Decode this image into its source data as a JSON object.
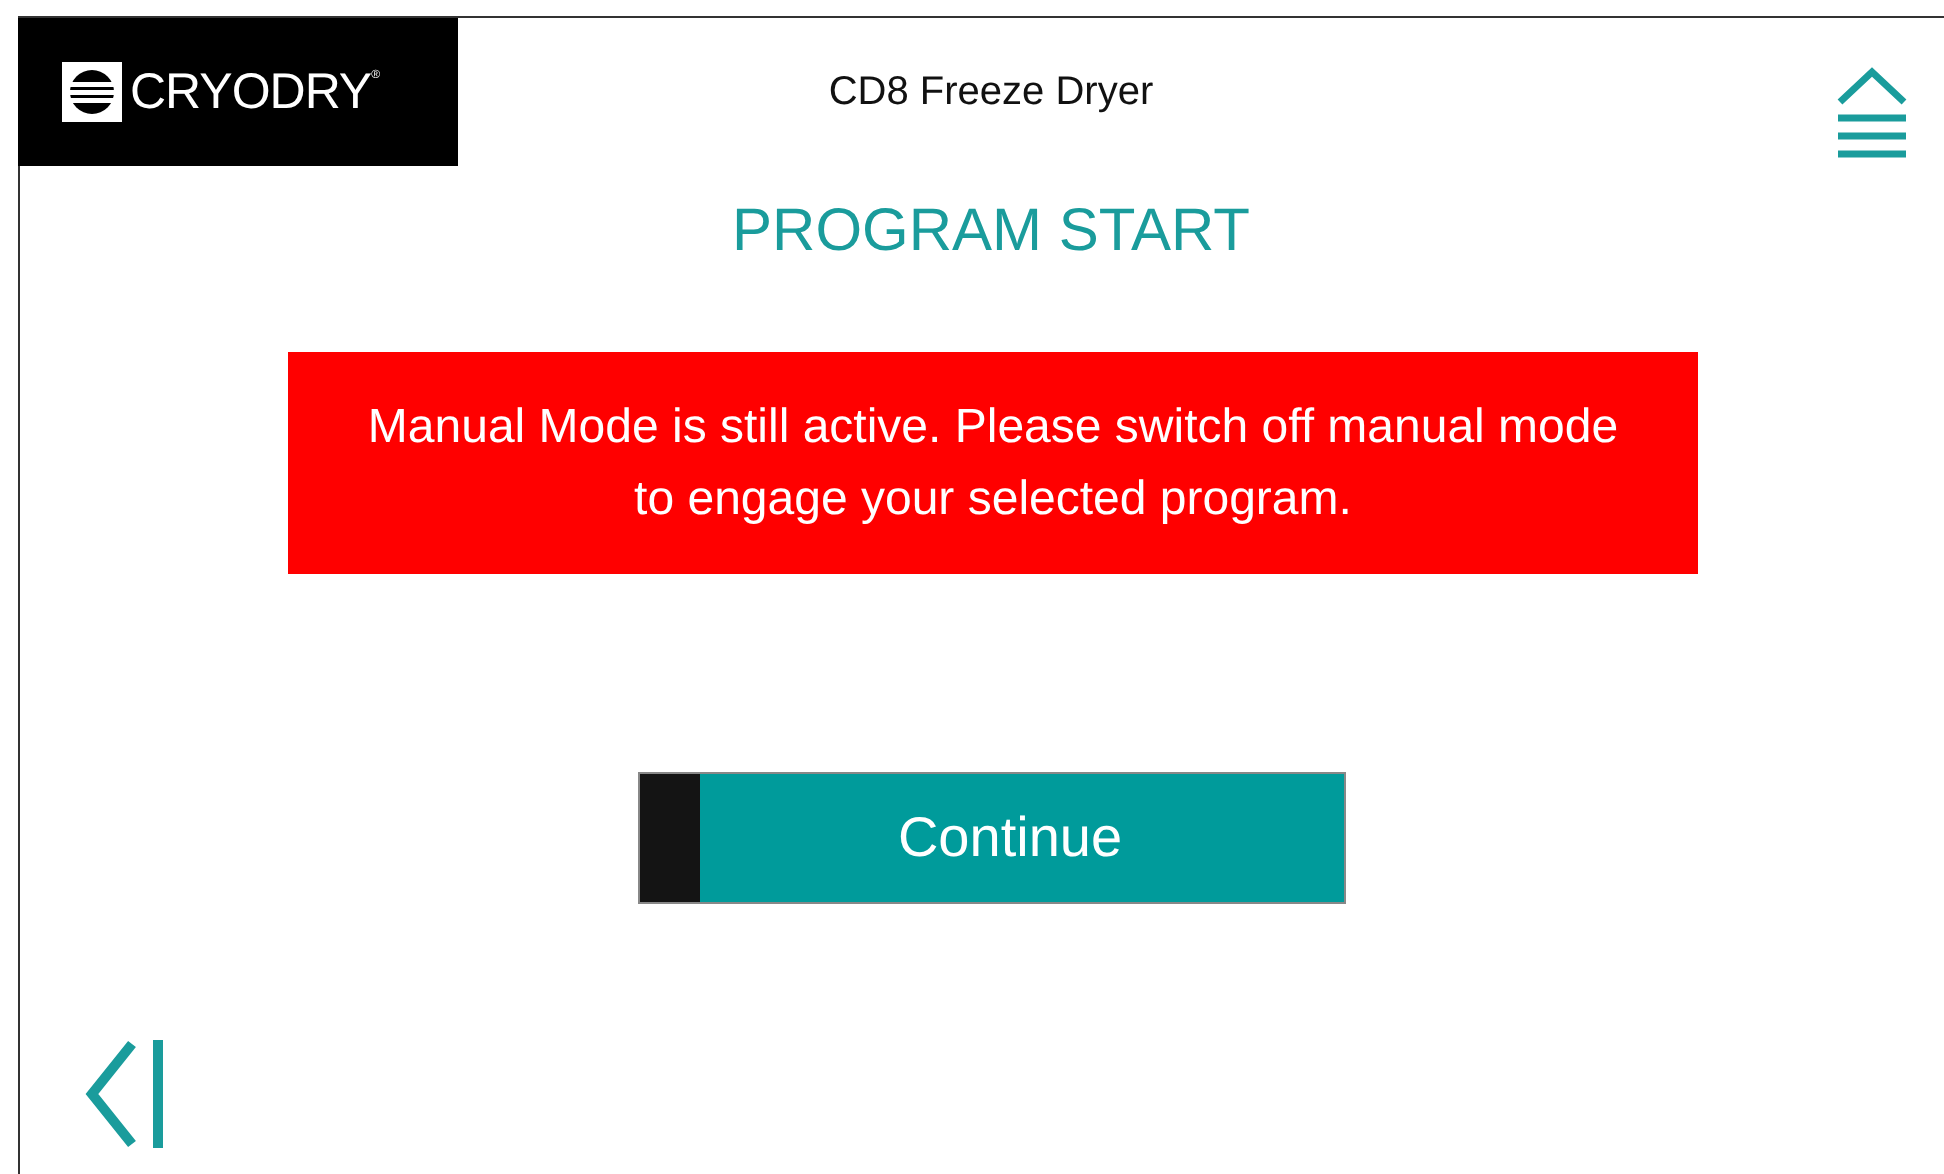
{
  "logo": {
    "text": "CRYODRY$^{®}$"
  },
  "header": {
    "title": "CD8 Freeze Dryer"
  },
  "screen_title": "PROGRAM START",
  "alert": {
    "message": "Manual Mode is still active. Please switch off manual mode to engage your selected program."
  },
  "continue_button": {
    "label": "Continue"
  }
}
